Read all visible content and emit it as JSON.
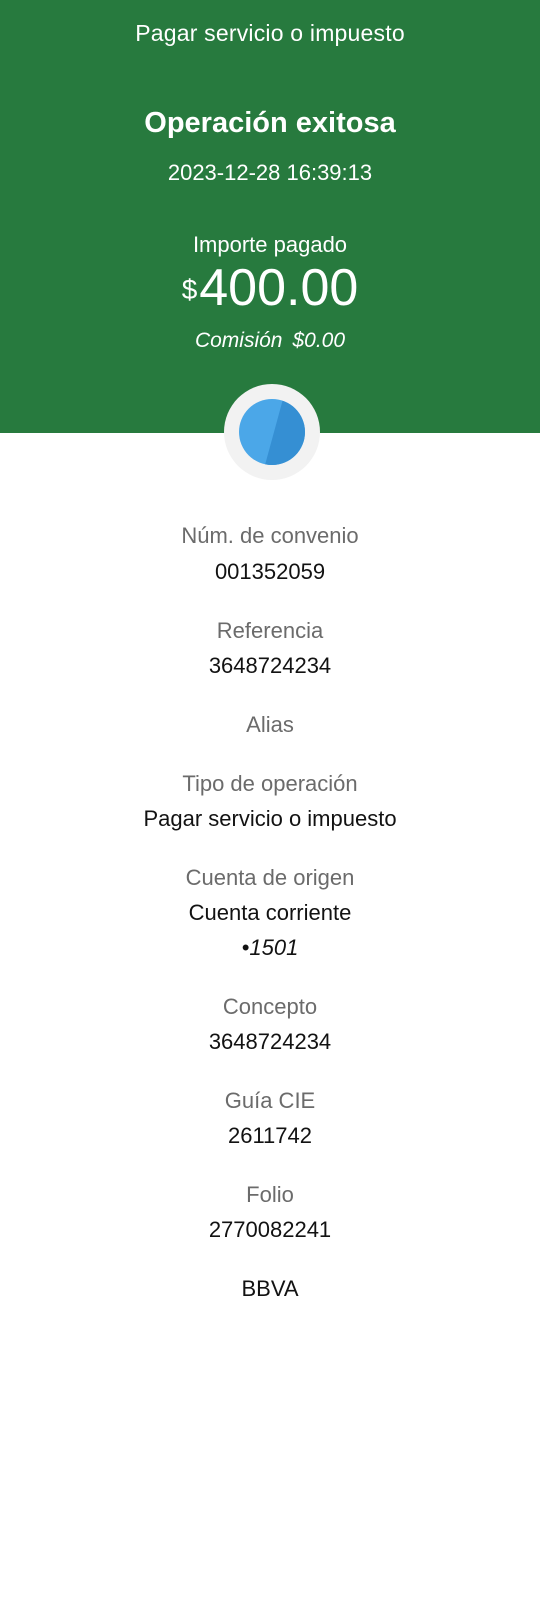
{
  "header": {
    "screen_title": "Pagar servicio o impuesto",
    "status_title": "Operación exitosa",
    "timestamp": "2023-12-28 16:39:13",
    "amount_label": "Importe pagado",
    "currency_symbol": "$",
    "amount": "400.00",
    "commission_label": "Comisión",
    "commission_value": "$0.00",
    "background_color": "#277a3e"
  },
  "status_icon": {
    "name": "status-circle-icon",
    "color_light": "#4ba7e8",
    "color_dark": "#358fd3"
  },
  "details": {
    "convenio_label": "Núm. de convenio",
    "convenio_value": "001352059",
    "referencia_label": "Referencia",
    "referencia_value": "3648724234",
    "alias_label": "Alias",
    "tipo_label": "Tipo de operación",
    "tipo_value": "Pagar servicio o impuesto",
    "cuenta_label": "Cuenta de origen",
    "cuenta_value": "Cuenta corriente",
    "cuenta_number": "•1501",
    "concepto_label": "Concepto",
    "concepto_value": "3648724234",
    "guia_label": "Guía CIE",
    "guia_value": "2611742",
    "folio_label": "Folio",
    "folio_value": "2770082241",
    "bank_name": "BBVA"
  }
}
